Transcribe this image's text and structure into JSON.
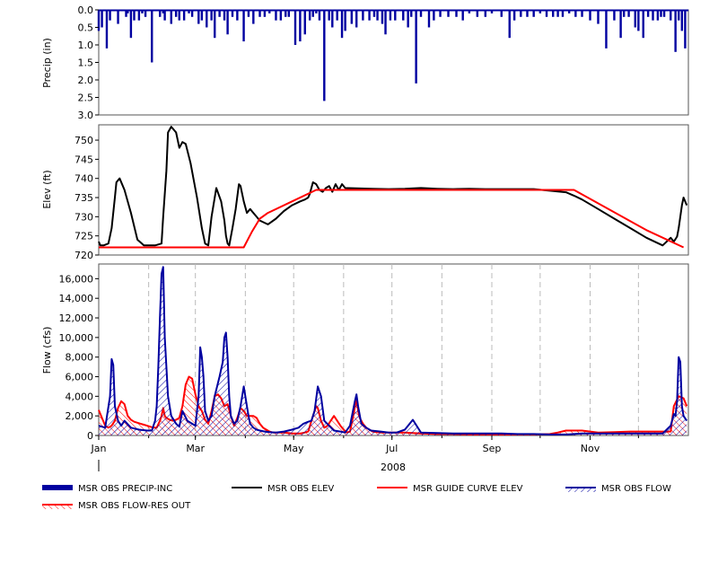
{
  "chart_data": [
    {
      "type": "bar",
      "ylabel": "Precip (in)",
      "ylim": [
        3.0,
        0.0
      ],
      "inverted": true,
      "yticks": [
        "0.0",
        "0.5",
        "1.0",
        "1.5",
        "2.0",
        "2.5",
        "3.0"
      ],
      "ytick_values": [
        0.0,
        0.5,
        1.0,
        1.5,
        2.0,
        2.5,
        3.0
      ],
      "series": [
        {
          "name": "MSR OBS PRECIP-INC",
          "color": "#0000a0",
          "x": [
            0,
            2,
            5,
            7,
            12,
            17,
            18,
            20,
            22,
            25,
            27,
            29,
            33,
            38,
            40,
            41,
            45,
            48,
            50,
            53,
            56,
            58,
            62,
            64,
            67,
            70,
            72,
            75,
            78,
            80,
            83,
            86,
            90,
            93,
            96,
            100,
            103,
            106,
            110,
            113,
            116,
            118,
            122,
            125,
            128,
            131,
            133,
            135,
            137,
            140,
            143,
            145,
            148,
            151,
            153,
            157,
            160,
            164,
            168,
            171,
            173,
            176,
            178,
            181,
            184,
            189,
            192,
            194,
            197,
            200,
            205,
            208,
            212,
            217,
            222,
            226,
            230,
            235,
            240,
            244,
            250,
            255,
            258,
            262,
            266,
            270,
            274,
            278,
            282,
            285,
            288,
            292,
            296,
            300,
            305,
            310,
            315,
            320,
            324,
            326,
            329,
            333,
            335,
            338,
            341,
            344,
            347,
            349,
            351,
            355,
            358,
            360,
            362,
            364
          ],
          "values": [
            0.6,
            0.5,
            1.1,
            0.3,
            0.4,
            0.2,
            0.1,
            0.8,
            0.3,
            0.3,
            0.1,
            0.2,
            1.5,
            0.2,
            0.1,
            0.3,
            0.4,
            0.2,
            0.3,
            0.3,
            0.1,
            0.2,
            0.4,
            0.3,
            0.5,
            0.3,
            0.8,
            0.2,
            0.3,
            0.7,
            0.2,
            0.3,
            0.9,
            0.2,
            0.4,
            0.2,
            0.2,
            0.1,
            0.3,
            0.3,
            0.2,
            0.2,
            1.0,
            0.9,
            0.7,
            0.3,
            0.2,
            0.1,
            0.3,
            2.6,
            0.3,
            0.5,
            0.3,
            0.8,
            0.6,
            0.4,
            0.5,
            0.3,
            0.3,
            0.2,
            0.3,
            0.4,
            0.7,
            0.3,
            0.3,
            0.3,
            0.5,
            0.2,
            2.1,
            0.2,
            0.5,
            0.3,
            0.2,
            0.2,
            0.2,
            0.3,
            0.1,
            0.2,
            0.2,
            0.1,
            0.2,
            0.8,
            0.3,
            0.2,
            0.2,
            0.2,
            0.1,
            0.2,
            0.2,
            0.2,
            0.2,
            0.1,
            0.2,
            0.2,
            0.3,
            0.4,
            1.1,
            0.3,
            0.8,
            0.2,
            0.2,
            0.5,
            0.6,
            0.8,
            0.2,
            0.3,
            0.3,
            0.2,
            0.2,
            0.3,
            1.2,
            0.3,
            0.6,
            1.1
          ]
        }
      ]
    },
    {
      "type": "line",
      "ylabel": "Elev (ft)",
      "ylim": [
        720,
        754
      ],
      "yticks": [
        "720",
        "725",
        "730",
        "735",
        "740",
        "745",
        "750"
      ],
      "ytick_values": [
        720,
        725,
        730,
        735,
        740,
        745,
        750
      ],
      "series": [
        {
          "name": "MSR OBS ELEV",
          "color": "#000000",
          "x": [
            0,
            1,
            3,
            6,
            8,
            10,
            11,
            13,
            16,
            20,
            24,
            28,
            30,
            35,
            39,
            40,
            42,
            43,
            45,
            48,
            50,
            52,
            54,
            57,
            61,
            64,
            66,
            68,
            70,
            73,
            76,
            78,
            79,
            80,
            81,
            83,
            85,
            87,
            88,
            90,
            92,
            94,
            96,
            98,
            100,
            105,
            110,
            115,
            120,
            125,
            128,
            130,
            131,
            133,
            135,
            137,
            139,
            141,
            143,
            145,
            147,
            149,
            151,
            153,
            160,
            170,
            180,
            190,
            200,
            210,
            220,
            230,
            240,
            250,
            260,
            270,
            280,
            290,
            295,
            300,
            310,
            320,
            330,
            340,
            350,
            355,
            357,
            359,
            360,
            361,
            362,
            363,
            364,
            365
          ],
          "values": [
            723.5,
            722.5,
            722.5,
            723,
            727,
            735,
            739,
            740,
            737,
            731,
            724,
            722.5,
            722.5,
            722.5,
            723,
            730,
            742,
            752,
            753.5,
            752,
            748,
            749.5,
            749,
            744,
            735,
            727,
            723,
            722.5,
            730,
            737.5,
            734,
            729,
            725,
            723,
            722.5,
            727,
            732,
            738.5,
            738,
            734,
            731,
            732,
            731,
            730,
            729,
            728,
            729.5,
            731.5,
            733,
            734,
            734.5,
            735,
            736,
            739,
            738.5,
            737,
            736.5,
            737.5,
            738,
            736.5,
            738.5,
            737,
            738.5,
            737.5,
            737.4,
            737.3,
            737.2,
            737.3,
            737.5,
            737.3,
            737.2,
            737.3,
            737.2,
            737.2,
            737.2,
            737.2,
            736.8,
            736.4,
            735.5,
            734.5,
            732,
            729.5,
            727,
            724.5,
            722.5,
            724.5,
            723.5,
            724.8,
            727,
            730,
            733,
            735,
            734,
            733
          ]
        },
        {
          "name": "MSR GUIDE CURVE ELEV",
          "color": "#ff0000",
          "x": [
            0,
            90,
            95,
            100,
            105,
            120,
            135,
            200,
            250,
            295,
            340,
            363
          ],
          "values": [
            722.0,
            722.0,
            726.0,
            729.5,
            731.0,
            734.0,
            737.0,
            737.0,
            737.0,
            737.0,
            726.5,
            722.0
          ]
        }
      ]
    },
    {
      "type": "area",
      "ylabel": "Flow (cfs)",
      "xlabel": "2008",
      "ylim": [
        0,
        17500
      ],
      "yticks": [
        "0",
        "2,000",
        "4,000",
        "6,000",
        "8,000",
        "10,000",
        "12,000",
        "14,000",
        "16,000"
      ],
      "ytick_values": [
        0,
        2000,
        4000,
        6000,
        8000,
        10000,
        12000,
        14000,
        16000
      ],
      "xticks": [
        "Jan",
        "Mar",
        "May",
        "Jul",
        "Sep",
        "Nov"
      ],
      "xtick_values": [
        0,
        60,
        121,
        182,
        244,
        305
      ],
      "xlim": [
        0,
        366
      ],
      "grid": "dashed vertical at month starts",
      "series": [
        {
          "name": "MSR OBS FLOW",
          "color": "#0000a0",
          "x": [
            0,
            4,
            7,
            8,
            9,
            10,
            12,
            14,
            16,
            20,
            25,
            30,
            33,
            35,
            36,
            37,
            38,
            39,
            40,
            41,
            43,
            45,
            48,
            50,
            52,
            55,
            58,
            60,
            62,
            63,
            64,
            65,
            66,
            68,
            70,
            72,
            75,
            77,
            78,
            79,
            80,
            81,
            82,
            84,
            86,
            88,
            90,
            92,
            93,
            94,
            96,
            98,
            100,
            103,
            106,
            110,
            115,
            120,
            124,
            127,
            130,
            132,
            134,
            136,
            138,
            140,
            143,
            146,
            150,
            153,
            156,
            159,
            160,
            161,
            163,
            166,
            169,
            175,
            180,
            185,
            190,
            195,
            200,
            210,
            220,
            230,
            240,
            250,
            260,
            270,
            280,
            290,
            300,
            310,
            320,
            330,
            340,
            350,
            355,
            357,
            358,
            359,
            360,
            361,
            362,
            363,
            365
          ],
          "values": [
            1000,
            800,
            4000,
            7800,
            7200,
            3000,
            1500,
            1000,
            1500,
            800,
            600,
            500,
            500,
            1500,
            3000,
            7000,
            12000,
            16500,
            17200,
            10000,
            4000,
            2000,
            1200,
            900,
            2500,
            1500,
            1200,
            1000,
            4000,
            9000,
            8000,
            6000,
            2500,
            1500,
            2000,
            4000,
            6000,
            7500,
            10000,
            10500,
            8000,
            4000,
            2000,
            1200,
            1500,
            3000,
            5000,
            3000,
            2000,
            1200,
            800,
            600,
            500,
            400,
            350,
            300,
            400,
            600,
            800,
            1200,
            1400,
            1500,
            2500,
            5000,
            4000,
            1500,
            1000,
            500,
            400,
            300,
            1000,
            3500,
            4200,
            3000,
            1200,
            800,
            500,
            400,
            300,
            300,
            600,
            1600,
            300,
            250,
            200,
            200,
            200,
            200,
            150,
            150,
            100,
            100,
            200,
            200,
            200,
            200,
            200,
            200,
            1000,
            2200,
            2000,
            3500,
            8000,
            7500,
            3000,
            2000,
            1500
          ]
        },
        {
          "name": "MSR OBS FLOW-RES OUT",
          "color": "#ff0000",
          "x": [
            0,
            2,
            4,
            6,
            8,
            10,
            12,
            14,
            16,
            18,
            20,
            22,
            24,
            26,
            28,
            30,
            32,
            34,
            36,
            38,
            39,
            40,
            41,
            42,
            44,
            46,
            48,
            50,
            52,
            54,
            56,
            58,
            60,
            62,
            64,
            66,
            68,
            70,
            72,
            74,
            76,
            78,
            80,
            82,
            84,
            86,
            88,
            90,
            92,
            94,
            96,
            98,
            100,
            102,
            104,
            106,
            108,
            110,
            115,
            120,
            125,
            128,
            130,
            133,
            135,
            136,
            138,
            140,
            142,
            144,
            146,
            148,
            150,
            152,
            154,
            156,
            158,
            160,
            161,
            162,
            164,
            166,
            170,
            175,
            180,
            185,
            190,
            200,
            210,
            220,
            230,
            240,
            250,
            260,
            270,
            280,
            285,
            290,
            300,
            310,
            320,
            330,
            340,
            350,
            355,
            357,
            360,
            363,
            365
          ],
          "values": [
            2600,
            1800,
            1000,
            800,
            1000,
            1500,
            2800,
            3500,
            3200,
            2000,
            1600,
            1400,
            1300,
            1200,
            1100,
            1000,
            900,
            800,
            800,
            1500,
            2000,
            2800,
            2000,
            1800,
            1600,
            1500,
            1600,
            1800,
            3000,
            5200,
            6000,
            5800,
            4200,
            3000,
            2500,
            1600,
            1200,
            2500,
            4000,
            4200,
            3800,
            3000,
            3200,
            2000,
            1000,
            1800,
            2800,
            2500,
            2000,
            2000,
            2000,
            1800,
            1200,
            800,
            600,
            400,
            300,
            300,
            300,
            200,
            200,
            300,
            400,
            2000,
            3000,
            2800,
            1500,
            800,
            1000,
            1500,
            2000,
            1500,
            1000,
            600,
            300,
            400,
            2000,
            3800,
            2500,
            1800,
            1200,
            800,
            400,
            300,
            300,
            300,
            300,
            200,
            150,
            150,
            100,
            100,
            100,
            100,
            100,
            150,
            300,
            500,
            500,
            300,
            350,
            400,
            400,
            400,
            400,
            3000,
            4000,
            3800,
            3000
          ]
        }
      ]
    }
  ],
  "legend": [
    {
      "label": "MSR OBS PRECIP-INC",
      "style": "thick-bar",
      "color": "#0000a0"
    },
    {
      "label": "MSR OBS ELEV",
      "style": "line",
      "color": "#000000"
    },
    {
      "label": "MSR GUIDE CURVE ELEV",
      "style": "line",
      "color": "#ff0000"
    },
    {
      "label": "MSR OBS FLOW",
      "style": "hatched",
      "color": "#0000a0"
    },
    {
      "label": "MSR OBS FLOW-RES OUT",
      "style": "hatched",
      "color": "#ff0000"
    }
  ]
}
